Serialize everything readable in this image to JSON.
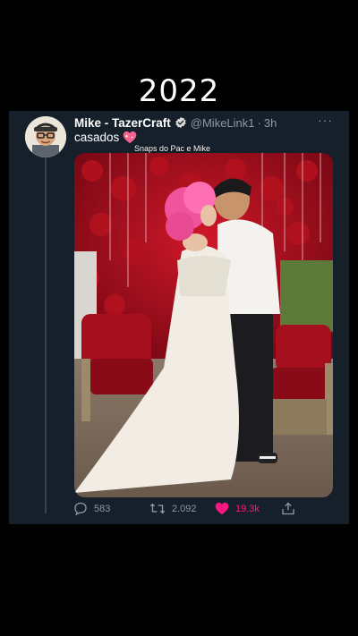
{
  "overlay": {
    "year": "2022"
  },
  "tweet": {
    "author_name": "Mike - TazerCraft",
    "handle": "@MikeLink1",
    "separator": "·",
    "time": "3h",
    "more": "···",
    "text": "casados",
    "emoji": "sparkling-heart-icon",
    "media_caption": "Snaps do Pac e Mike",
    "actions": {
      "replies": "583",
      "retweets": "2.092",
      "likes": "19.3k",
      "liked": true
    }
  },
  "colors": {
    "background": "#000000",
    "tweet_bg": "#15202b",
    "secondary_text": "#8b98a5",
    "verified": "#1d9bf0",
    "like": "#f91880"
  }
}
